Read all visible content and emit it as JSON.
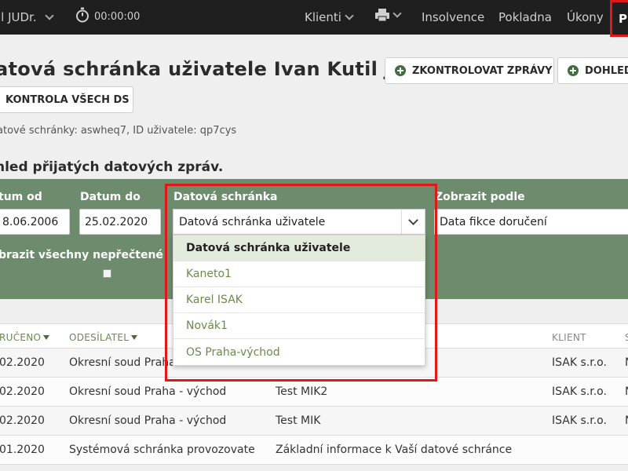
{
  "topbar": {
    "user": "il JUDr.",
    "timer": "00:00:00",
    "nav": [
      "Klienti",
      "Insolvence",
      "Pokladna",
      "Úkony"
    ],
    "active_item": "P"
  },
  "page": {
    "title": "atová schránka uživatele Ivan Kutil JUDr.",
    "btn_check": "ZKONTROLOVAT ZPRÁVY",
    "btn_find": "DOHLED",
    "btn_all": "KONTROLA VŠECH DS",
    "ds_info": "atové schránky: aswheq7, ID uživatele: qp7cys",
    "section_title": "hled přijatých datových zpráv."
  },
  "filter": {
    "date_from_label": "tum od",
    "date_from_value": "8.06.2006",
    "date_to_label": "Datum do",
    "date_to_value": "25.02.2020",
    "box_label": "Datová schránka",
    "box_value": "Datová schránka uživatele",
    "show_label": "Zobrazit podle",
    "show_value": "Data fikce doručení",
    "unread_label": "brazit všechny nepřečtené"
  },
  "dropdown_options": [
    "Datová schránka uživatele",
    "Kaneto1",
    "Karel ISAK",
    "Novák1",
    "OS Praha-východ"
  ],
  "table": {
    "headers": {
      "delivered": "RUČENO",
      "sender": "ODESÍLATEL",
      "client": "KLIENT",
      "last": "S"
    },
    "rows": [
      {
        "date": "02.2020",
        "sender": "Okresní soud Praha",
        "subject": "",
        "client": "ISAK s.r.o.",
        "extra": "N"
      },
      {
        "date": "02.2020",
        "sender": "Okresní soud Praha - východ",
        "subject": "Test MIK2",
        "client": "ISAK s.r.o.",
        "extra": "N"
      },
      {
        "date": "02.2020",
        "sender": "Okresní soud Praha - východ",
        "subject": "Test MIK",
        "client": "ISAK s.r.o.",
        "extra": "N"
      },
      {
        "date": "01.2020",
        "sender": "Systémová schránka provozovate",
        "subject": "Základní informace k Vaší datové schránce",
        "client": "",
        "extra": ""
      }
    ]
  }
}
